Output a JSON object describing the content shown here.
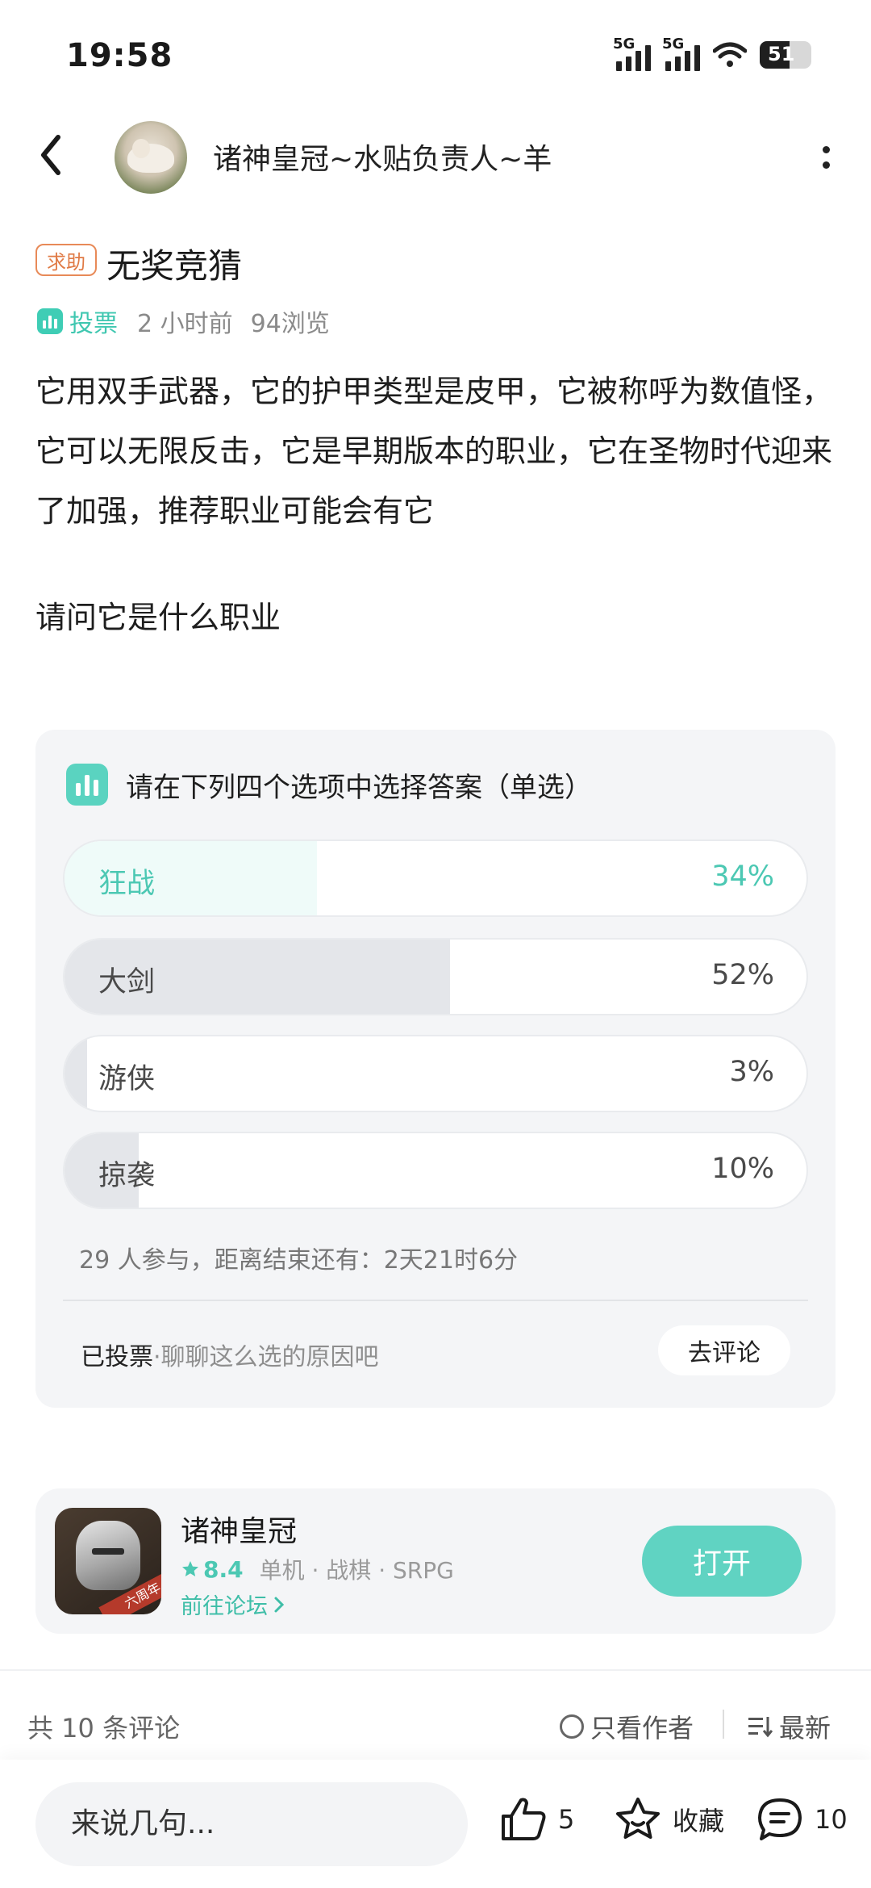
{
  "status_bar": {
    "time": "19:58",
    "network_1": "5G",
    "network_2": "5G",
    "battery": "51"
  },
  "header": {
    "author": "诸神皇冠~水贴负责人~羊"
  },
  "post": {
    "tag": "求助",
    "title": "无奖竞猜",
    "type_label": "投票",
    "time_ago": "2 小时前",
    "views": "94浏览",
    "body": "它用双手武器，它的护甲类型是皮甲，它被称呼为数值怪，它可以无限反击，它是早期版本的职业，它在圣物时代迎来了加强，推荐职业可能会有它",
    "question": "请问它是什么职业"
  },
  "poll": {
    "question": "请在下列四个选项中选择答案（单选）",
    "options": [
      {
        "label": "狂战",
        "percent": "34%",
        "value": 34,
        "selected": true
      },
      {
        "label": "大剑",
        "percent": "52%",
        "value": 52,
        "selected": false
      },
      {
        "label": "游侠",
        "percent": "3%",
        "value": 3,
        "selected": false
      },
      {
        "label": "掠袭",
        "percent": "10%",
        "value": 10,
        "selected": false
      }
    ],
    "stats": "29 人参与，距离结束还有：2天21时6分",
    "voted_label": "已投票",
    "voted_hint": "·聊聊这么选的原因吧",
    "comment_button": "去评论"
  },
  "game": {
    "name": "诸神皇冠",
    "rating": "8.4",
    "tags": "单机 · 战棋 · SRPG",
    "forum_link": "前往论坛",
    "open_button": "打开",
    "icon_text": "六周年"
  },
  "comments": {
    "count": "共 10 条评论",
    "only_author": "只看作者",
    "sort": "最新"
  },
  "bottom_bar": {
    "input_placeholder": "来说几句...",
    "likes": "5",
    "favorite": "收藏",
    "comments": "10"
  },
  "colors": {
    "accent": "#4cc8b3",
    "tag": "#e07a45",
    "open_button": "#60d3c2"
  }
}
